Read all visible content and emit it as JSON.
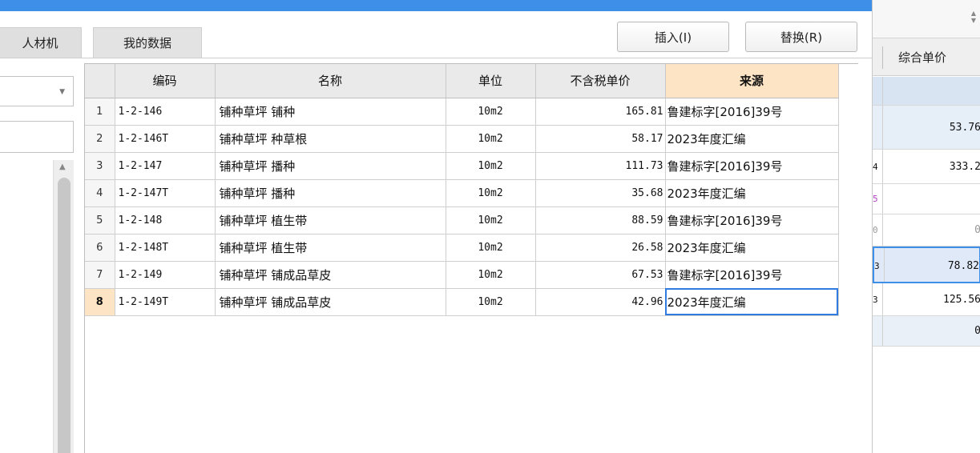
{
  "tabs": [
    {
      "label": "人材机"
    },
    {
      "label": "我的数据"
    }
  ],
  "buttons": {
    "insert": "插入(I)",
    "replace": "替换(R)"
  },
  "grid": {
    "columns": [
      "编码",
      "名称",
      "单位",
      "不含税单价",
      "来源"
    ],
    "rows": [
      {
        "idx": "1",
        "code": "1-2-146",
        "name": "铺种草坪 铺种",
        "unit": "10m2",
        "price": "165.81",
        "source": "鲁建标字[2016]39号"
      },
      {
        "idx": "2",
        "code": "1-2-146T",
        "name": "铺种草坪 种草根",
        "unit": "10m2",
        "price": "58.17",
        "source": "2023年度汇编"
      },
      {
        "idx": "3",
        "code": "1-2-147",
        "name": "铺种草坪 播种",
        "unit": "10m2",
        "price": "111.73",
        "source": "鲁建标字[2016]39号"
      },
      {
        "idx": "4",
        "code": "1-2-147T",
        "name": "铺种草坪 播种",
        "unit": "10m2",
        "price": "35.68",
        "source": "2023年度汇编"
      },
      {
        "idx": "5",
        "code": "1-2-148",
        "name": "铺种草坪 植生带",
        "unit": "10m2",
        "price": "88.59",
        "source": "鲁建标字[2016]39号"
      },
      {
        "idx": "6",
        "code": "1-2-148T",
        "name": "铺种草坪 植生带",
        "unit": "10m2",
        "price": "26.58",
        "source": "2023年度汇编"
      },
      {
        "idx": "7",
        "code": "1-2-149",
        "name": "铺种草坪 铺成品草皮",
        "unit": "10m2",
        "price": "67.53",
        "source": "鲁建标字[2016]39号"
      },
      {
        "idx": "8",
        "code": "1-2-149T",
        "name": "铺种草坪 铺成品草皮",
        "unit": "10m2",
        "price": "42.96",
        "source": "2023年度汇编"
      }
    ]
  },
  "right_panel": {
    "header": "综合单价",
    "rows": [
      {
        "left": "",
        "value": ""
      },
      {
        "left": "",
        "value": "53.76"
      },
      {
        "left": "4",
        "value": "333.2"
      },
      {
        "left": "5",
        "value": ""
      },
      {
        "left": "0",
        "value": "0"
      },
      {
        "left": "3",
        "value": "78.82"
      },
      {
        "left": "3",
        "value": "125.56"
      },
      {
        "left": "",
        "value": "0"
      }
    ]
  },
  "colors": {
    "title_bar": "#3d8fe8",
    "selection": "#2f7be0",
    "highlight_header": "#fde4c4",
    "row_highlight": "#dfe9f7"
  }
}
